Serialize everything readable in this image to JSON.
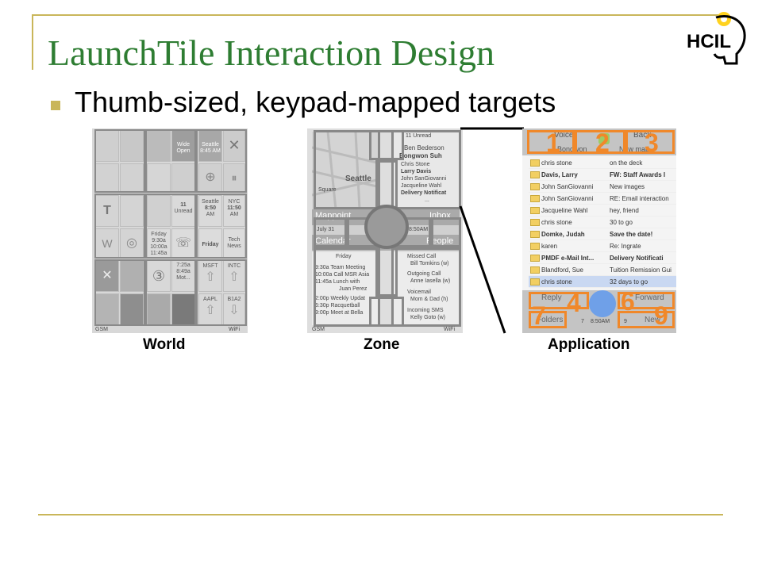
{
  "slide": {
    "title": "LaunchTile Interaction Design",
    "bullet": "Thumb-sized, keypad-mapped targets",
    "logo_text": "HCIL"
  },
  "panels": {
    "world": {
      "caption": "World",
      "tile_texts": {
        "wide_open": "Wide Open",
        "seattle_small": "Seattle 8:45 AM",
        "unread_count": "11",
        "unread": "Unread",
        "seattle": "Seattle",
        "seattle_time": "8:50",
        "seattle_am": "AM",
        "nyc": "NYC",
        "nyc_time": "11:50",
        "nyc_am": "AM",
        "friday": "Friday",
        "t930": "9:30a",
        "t1000": "10:00a",
        "t1145": "11:45a",
        "friday2": "Friday",
        "tech": "Tech",
        "news": "News",
        "msft": "MSFT",
        "intc": "INTC",
        "aapl": "AAPL",
        "b1a2": "B1A2",
        "t725": "7:25a",
        "t849": "8:49a",
        "mot": "Mot...",
        "gsm": "GSM",
        "wifi": "WiFi"
      }
    },
    "zone": {
      "caption": "Zone",
      "texts": {
        "unread": "11 Unread",
        "ben": "Ben Bederson",
        "bongwon": "Bongwon Suh",
        "chris": "Chris Stone",
        "larry": "Larry Davis",
        "john": "John SanGiovanni",
        "jacqueline": "Jacqueline Wahl",
        "delivery": "Delivery Notificat",
        "ellipsis": "...",
        "seattle": "Seattle",
        "square": "Square",
        "mappoint": "Mappoint",
        "inbox": "Inbox",
        "july": "July 31",
        "time": "8:50AM",
        "calendar": "Calendar",
        "people": "People",
        "friday": "Friday",
        "c1": "9:30a Team Meeting",
        "c2": "10:00a Call MSR Asia",
        "c3": "11:45a Lunch with",
        "c3b": "Juan Perez",
        "c4": "2:00p Weekly Updat",
        "c5": "6:30p Racquetball",
        "c6": "9:00p Meet at Bella",
        "p1": "Missed Call",
        "p1b": "Bill Tomkins (w)",
        "p2": "Outgoing Call",
        "p2b": "Anne Iasella (w)",
        "p3": "Voicemail",
        "p3b": "Mom & Dad (h)",
        "p4": "Incoming SMS",
        "p4b": "Kelly Goto (w)",
        "gsm": "GSM",
        "wifi": "WiFi"
      }
    },
    "application": {
      "caption": "Application",
      "top_labels": {
        "voice": "Voice",
        "back": "Back",
        "bongwon": "Bongwon",
        "newmap": "New map"
      },
      "mails": [
        {
          "from": "chris stone",
          "subject": "on the deck"
        },
        {
          "from": "Davis, Larry",
          "subject": "FW: Staff Awards l"
        },
        {
          "from": "John SanGiovanni",
          "subject": "New images"
        },
        {
          "from": "John SanGiovanni",
          "subject": "RE: Email interaction"
        },
        {
          "from": "Jacqueline Wahl",
          "subject": "hey, friend"
        },
        {
          "from": "chris stone",
          "subject": "30 to go"
        },
        {
          "from": "Domke, Judah",
          "subject": "Save the date!"
        },
        {
          "from": "karen",
          "subject": "Re: Ingrate"
        },
        {
          "from": "PMDF e-Mail Int...",
          "subject": "Delivery Notificati"
        },
        {
          "from": "Blandford, Sue",
          "subject": "Tuition Remission Gui"
        },
        {
          "from": "chris stone",
          "subject": "32 days to go"
        }
      ],
      "bottom_labels": {
        "reply": "Reply",
        "forward": "Forward",
        "folders": "Folders",
        "seven": "7",
        "time": "8:50AM",
        "nine": "9",
        "new": "New"
      },
      "keys": [
        "1",
        "2",
        "3",
        "4",
        "6",
        "7",
        "9"
      ]
    }
  },
  "colors": {
    "title": "#2e7d32",
    "accent": "#c9b65a",
    "key_orange": "#f0882a"
  }
}
